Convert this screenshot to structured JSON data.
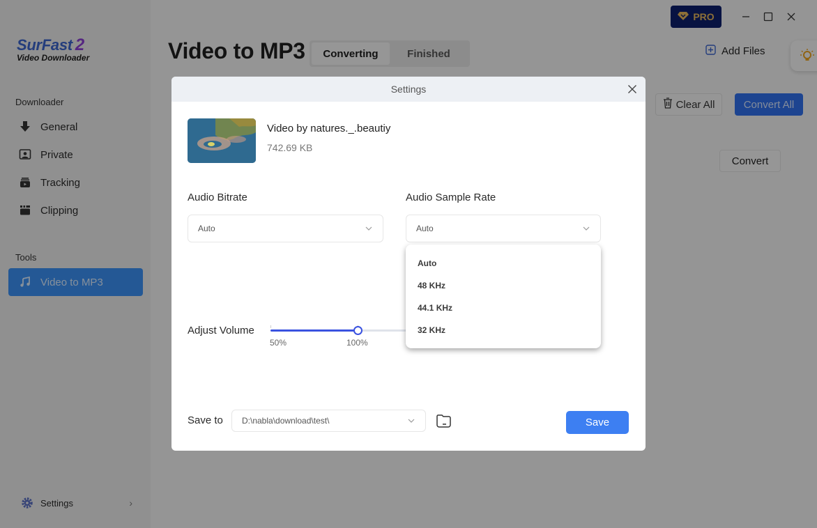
{
  "app": {
    "logo_title": "SurFast",
    "logo_version": "2",
    "logo_subtitle": "Video Downloader"
  },
  "sidebar": {
    "downloader_label": "Downloader",
    "downloader_items": [
      {
        "label": "General",
        "icon": "download-arrow-icon"
      },
      {
        "label": "Private",
        "icon": "private-user-icon"
      },
      {
        "label": "Tracking",
        "icon": "tracking-icon"
      },
      {
        "label": "Clipping",
        "icon": "clipping-icon"
      }
    ],
    "tools_label": "Tools",
    "tools_items": [
      {
        "label": "Video to MP3",
        "icon": "music-note-icon",
        "active": true
      }
    ],
    "settings_label": "Settings"
  },
  "header": {
    "page_title": "Video to MP3",
    "tabs": [
      {
        "label": "Converting",
        "active": true
      },
      {
        "label": "Finished",
        "active": false
      }
    ],
    "pro_label": "PRO",
    "add_files_label": "Add Files",
    "clear_all_label": "Clear All",
    "convert_all_label": "Convert All",
    "convert_label": "Convert"
  },
  "modal": {
    "title": "Settings",
    "file": {
      "name": "Video by natures._.beautiy",
      "size": "742.69 KB"
    },
    "audio_bitrate": {
      "label": "Audio Bitrate",
      "value": "Auto"
    },
    "audio_sample_rate": {
      "label": "Audio Sample Rate",
      "value": "Auto",
      "options": [
        "Auto",
        "48 KHz",
        "44.1 KHz",
        "32 KHz"
      ]
    },
    "volume": {
      "label": "Adjust Volume",
      "value_percent": 100,
      "min_percent": 50,
      "max_percent": 200,
      "tick_labels": [
        "50%",
        "100%"
      ]
    },
    "save_to": {
      "label": "Save to",
      "path": "D:\\nabla\\download\\test\\"
    },
    "save_label": "Save"
  },
  "colors": {
    "accent": "#3d7ff2",
    "slider": "#3a52e0",
    "pro_bg": "#0d1f6b",
    "pro_text": "#e3b45a"
  }
}
